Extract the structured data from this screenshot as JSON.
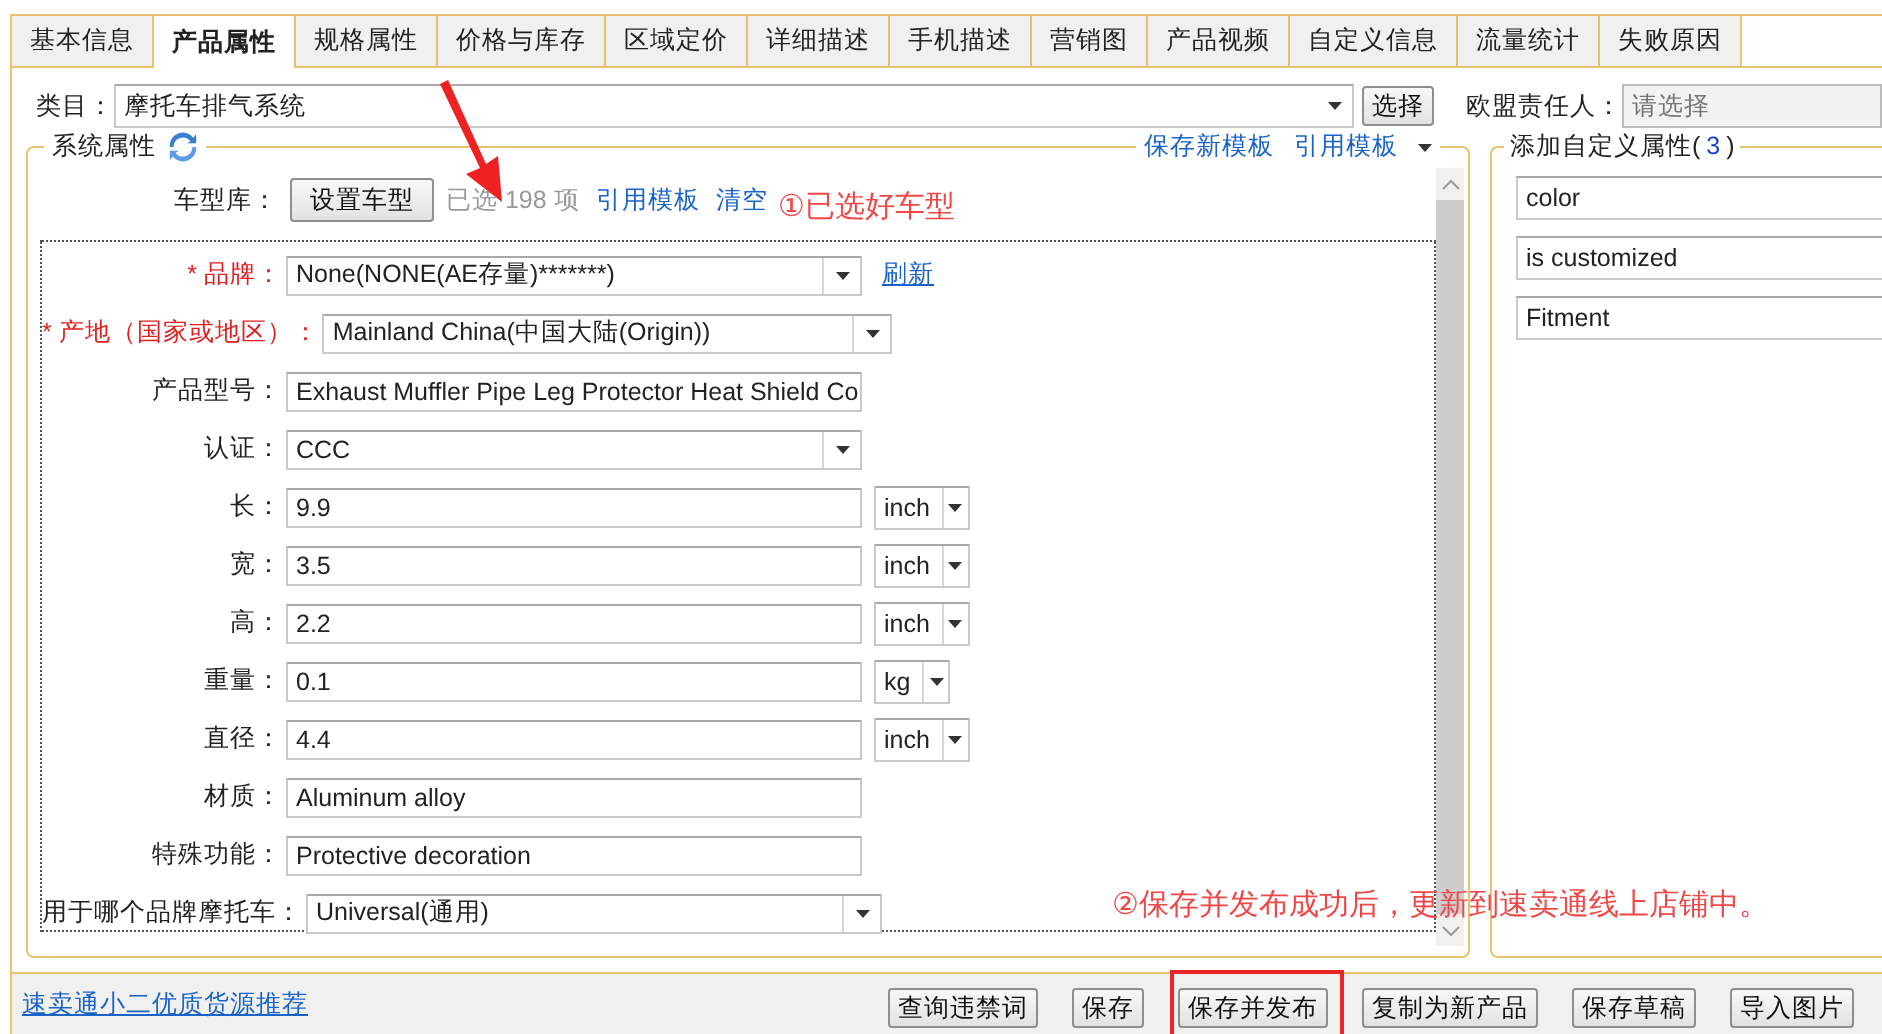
{
  "tabs": [
    {
      "label": "基本信息",
      "selected": false
    },
    {
      "label": "产品属性",
      "selected": true
    },
    {
      "label": "规格属性",
      "selected": false
    },
    {
      "label": "价格与库存",
      "selected": false
    },
    {
      "label": "区域定价",
      "selected": false
    },
    {
      "label": "详细描述",
      "selected": false
    },
    {
      "label": "手机描述",
      "selected": false
    },
    {
      "label": "营销图",
      "selected": false
    },
    {
      "label": "产品视频",
      "selected": false
    },
    {
      "label": "自定义信息",
      "selected": false
    },
    {
      "label": "流量统计",
      "selected": false
    },
    {
      "label": "失败原因",
      "selected": false
    }
  ],
  "category": {
    "label": "类目：",
    "value": "摩托车排气系统",
    "button": "选择"
  },
  "eu_person": {
    "label": "欧盟责任人：",
    "placeholder": "请选择"
  },
  "system_attributes": {
    "title": "系统属性",
    "links": [
      "保存新模板",
      "引用模板"
    ],
    "vehicle_library": {
      "label": "车型库：",
      "button": "设置车型",
      "count": "已选 198 项",
      "links": [
        "引用模板",
        "清空"
      ]
    },
    "fields": [
      {
        "kind": "select",
        "label": "* 品牌：",
        "required": true,
        "value": "None(NONE(AE存量)*******)",
        "link": "刷新"
      },
      {
        "kind": "select",
        "label": "* 产地（国家或地区）：",
        "required": true,
        "value": "Mainland China(中国大陆(Origin))"
      },
      {
        "kind": "text",
        "label": "产品型号：",
        "required": false,
        "value": "Exhaust Muffler Pipe Leg Protector Heat Shield Co"
      },
      {
        "kind": "select",
        "label": "认证：",
        "required": false,
        "value": "CCC"
      },
      {
        "kind": "measure",
        "label": "长：",
        "required": false,
        "value": "9.9",
        "unit": "inch"
      },
      {
        "kind": "measure",
        "label": "宽：",
        "required": false,
        "value": "3.5",
        "unit": "inch"
      },
      {
        "kind": "measure",
        "label": "高：",
        "required": false,
        "value": "2.2",
        "unit": "inch"
      },
      {
        "kind": "measure",
        "label": "重量：",
        "required": false,
        "value": "0.1",
        "unit": "kg"
      },
      {
        "kind": "measure",
        "label": "直径：",
        "required": false,
        "value": "4.4",
        "unit": "inch"
      },
      {
        "kind": "text",
        "label": "材质：",
        "required": false,
        "value": "Aluminum alloy"
      },
      {
        "kind": "text",
        "label": "特殊功能：",
        "required": false,
        "value": "Protective decoration"
      },
      {
        "kind": "select",
        "label": "用于哪个品牌摩托车：",
        "required": false,
        "value": "Universal(通用)"
      }
    ]
  },
  "custom_attributes": {
    "title": "添加自定义属性(",
    "count": "3",
    "title_end": ")",
    "items": [
      "color",
      "is customized",
      "Fitment"
    ]
  },
  "footer": {
    "link": "速卖通小二优质货源推荐",
    "buttons": [
      {
        "label": "查询违禁词",
        "highlighted": false
      },
      {
        "label": "保存",
        "highlighted": false
      },
      {
        "label": "保存并发布",
        "highlighted": true
      },
      {
        "label": "复制为新产品",
        "highlighted": false
      },
      {
        "label": "保存草稿",
        "highlighted": false
      },
      {
        "label": "导入图片",
        "highlighted": false
      }
    ]
  },
  "annotations": [
    {
      "kind": "arrow"
    },
    {
      "kind": "note",
      "text": "①已选好车型"
    },
    {
      "kind": "note",
      "text": "②保存并发布成功后，更新到速卖通线上店铺中。"
    }
  ]
}
